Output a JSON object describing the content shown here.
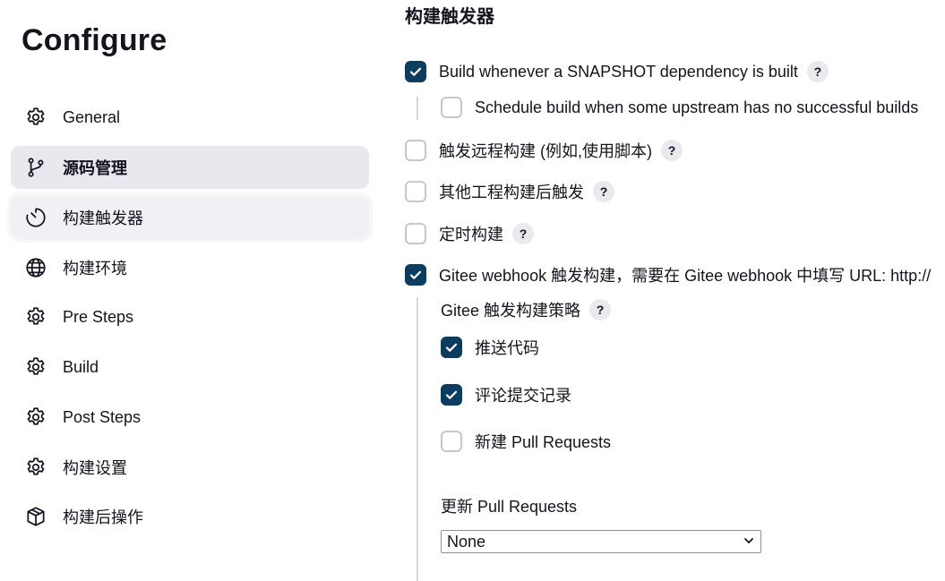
{
  "page_title": "Configure",
  "sidebar": {
    "items": [
      {
        "label": "General",
        "icon": "gear-icon"
      },
      {
        "label": "源码管理",
        "icon": "git-branch-icon"
      },
      {
        "label": "构建触发器",
        "icon": "timer-icon"
      },
      {
        "label": "构建环境",
        "icon": "globe-icon"
      },
      {
        "label": "Pre Steps",
        "icon": "gear-icon"
      },
      {
        "label": "Build",
        "icon": "gear-icon"
      },
      {
        "label": "Post Steps",
        "icon": "gear-icon"
      },
      {
        "label": "构建设置",
        "icon": "gear-icon"
      },
      {
        "label": "构建后操作",
        "icon": "package-icon"
      }
    ]
  },
  "main": {
    "section_title": "构建触发器",
    "options": {
      "snapshot": {
        "label": "Build whenever a SNAPSHOT dependency is built",
        "checked": true
      },
      "upstream": {
        "label": "Schedule build when some upstream has no successful builds",
        "checked": false
      },
      "remote": {
        "label": "触发远程构建 (例如,使用脚本)",
        "checked": false
      },
      "after_other": {
        "label": "其他工程构建后触发",
        "checked": false
      },
      "periodic": {
        "label": "定时构建",
        "checked": false
      },
      "gitee": {
        "label": "Gitee webhook 触发构建，需要在 Gitee webhook 中填写 URL: http://",
        "checked": true
      }
    },
    "gitee_strategy": {
      "label": "Gitee 触发构建策略",
      "push": {
        "label": "推送代码",
        "checked": true
      },
      "comment": {
        "label": "评论提交记录",
        "checked": true
      },
      "new_pr": {
        "label": "新建 Pull Requests",
        "checked": false
      }
    },
    "update_pr": {
      "label": "更新 Pull Requests",
      "selected": "None"
    },
    "help_label": "?"
  },
  "colors": {
    "accent": "#0d3d5e",
    "selected_bg": "#e8e9ee",
    "text": "#14141f"
  }
}
